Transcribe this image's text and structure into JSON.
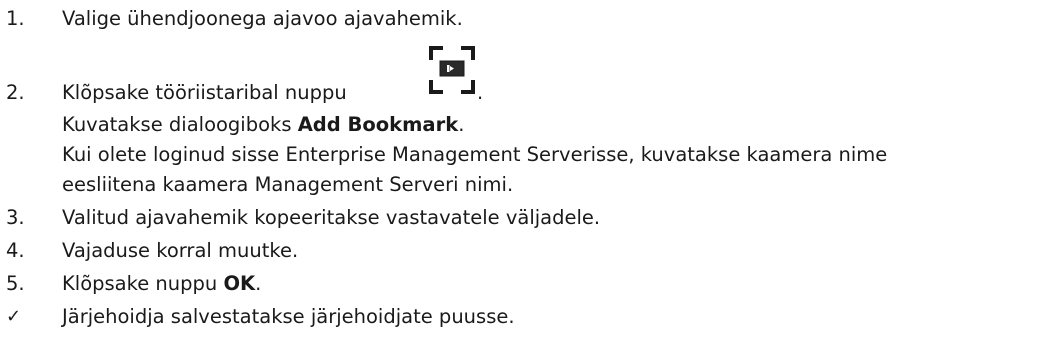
{
  "steps": [
    {
      "number": "1.",
      "text": "Valige ühendjoonega ajavoo ajavahemik."
    },
    {
      "number": "2.",
      "text_before_icon": "Klõpsake tööriistaribal nuppu",
      "text_after_icon": ".",
      "icon": "add-bookmark-icon",
      "sub_line_1_prefix": "Kuvatakse dialoogiboks ",
      "sub_line_1_bold": "Add Bookmark",
      "sub_line_1_suffix": ".",
      "sub_line_2": "Kui olete loginud sisse Enterprise Management Serverisse, kuvatakse kaamera nime",
      "sub_line_3": "eesliitena kaamera Management Serveri nimi."
    },
    {
      "number": "3.",
      "text": "Valitud ajavahemik kopeeritakse vastavatele väljadele."
    },
    {
      "number": "4.",
      "text": "Vajaduse korral muutke."
    },
    {
      "number": "5.",
      "text_prefix": "Klõpsake nuppu ",
      "text_bold": "OK",
      "text_suffix": "."
    }
  ],
  "result": {
    "symbol": "✓",
    "text": "Järjehoidja salvestatakse järjehoidjate puusse."
  }
}
